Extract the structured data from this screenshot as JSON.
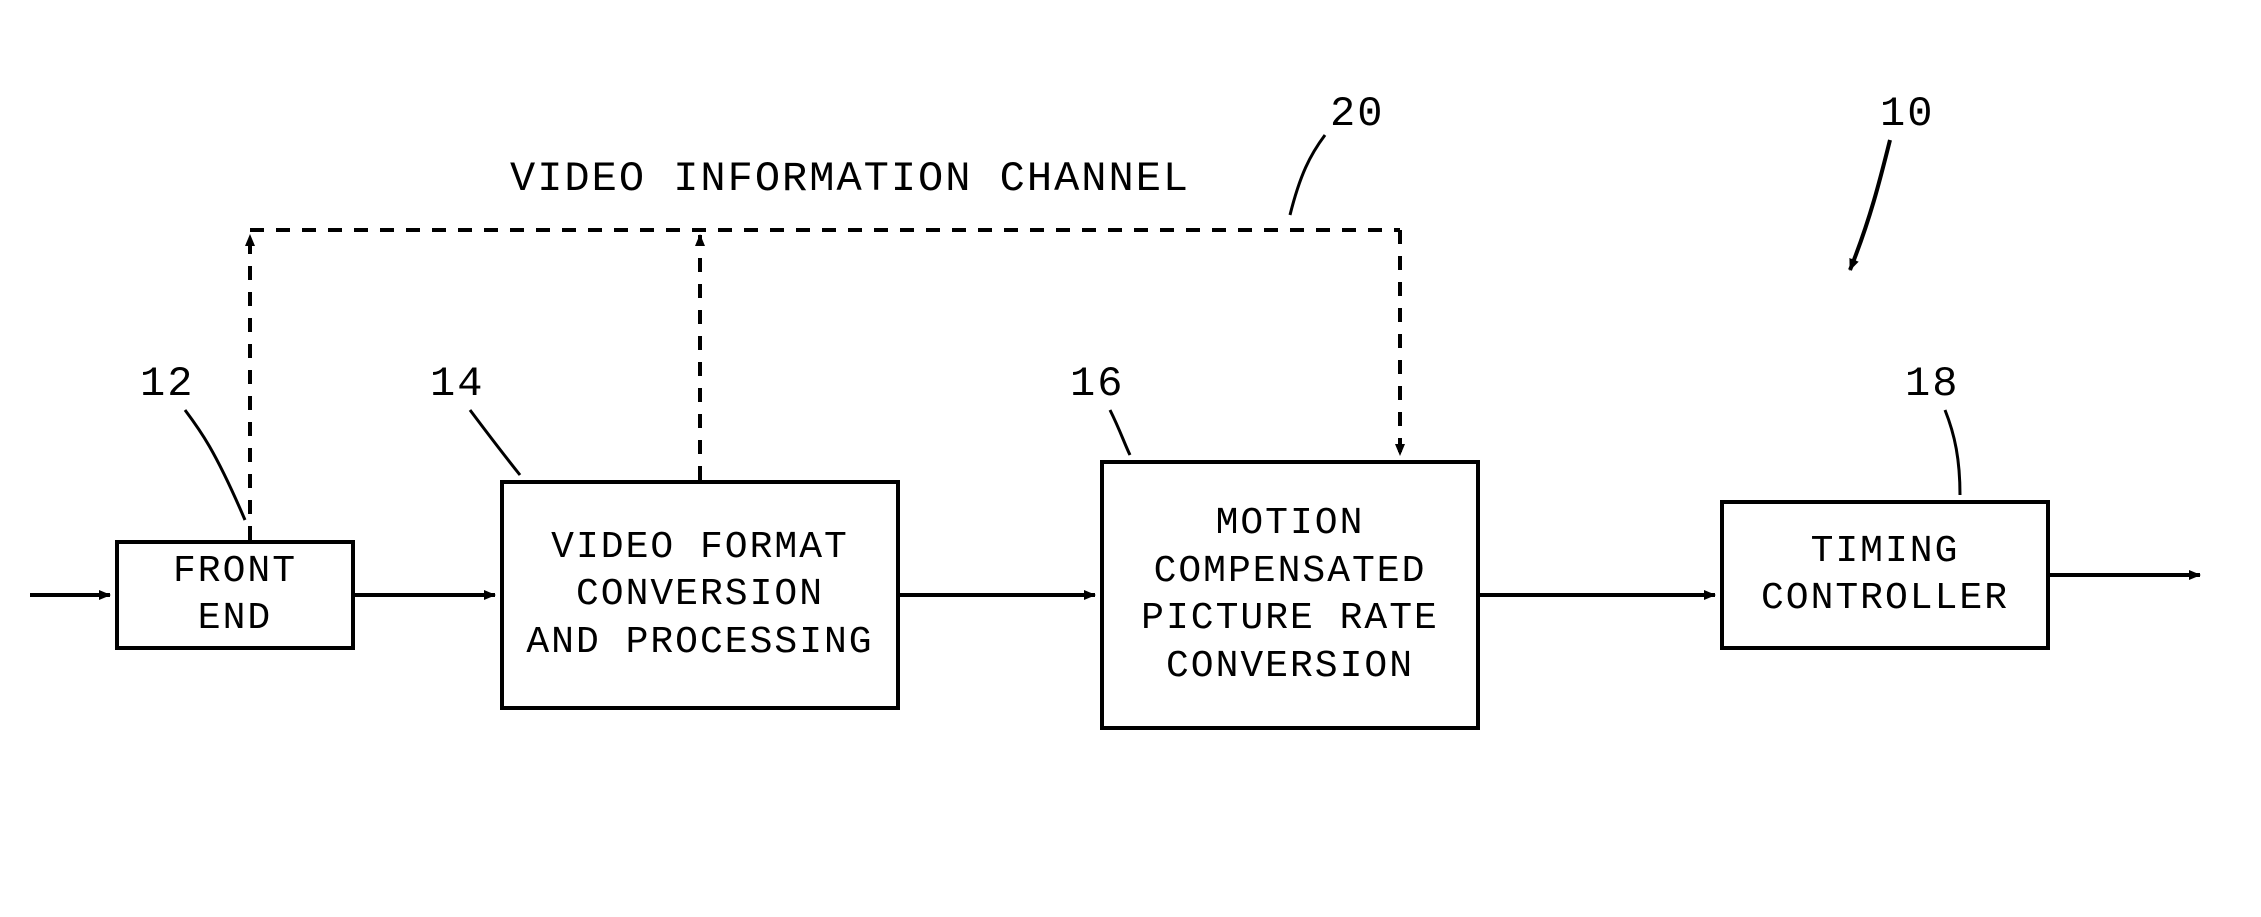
{
  "diagram_ref": "10",
  "channel": {
    "label": "VIDEO INFORMATION CHANNEL",
    "ref": "20"
  },
  "blocks": {
    "front_end": {
      "ref": "12",
      "label": "FRONT END"
    },
    "vfc": {
      "ref": "14",
      "label": "VIDEO FORMAT\nCONVERSION\nAND PROCESSING"
    },
    "mcprc": {
      "ref": "16",
      "label": "MOTION\nCOMPENSATED\nPICTURE RATE\nCONVERSION"
    },
    "timing": {
      "ref": "18",
      "label": "TIMING\nCONTROLLER"
    }
  }
}
